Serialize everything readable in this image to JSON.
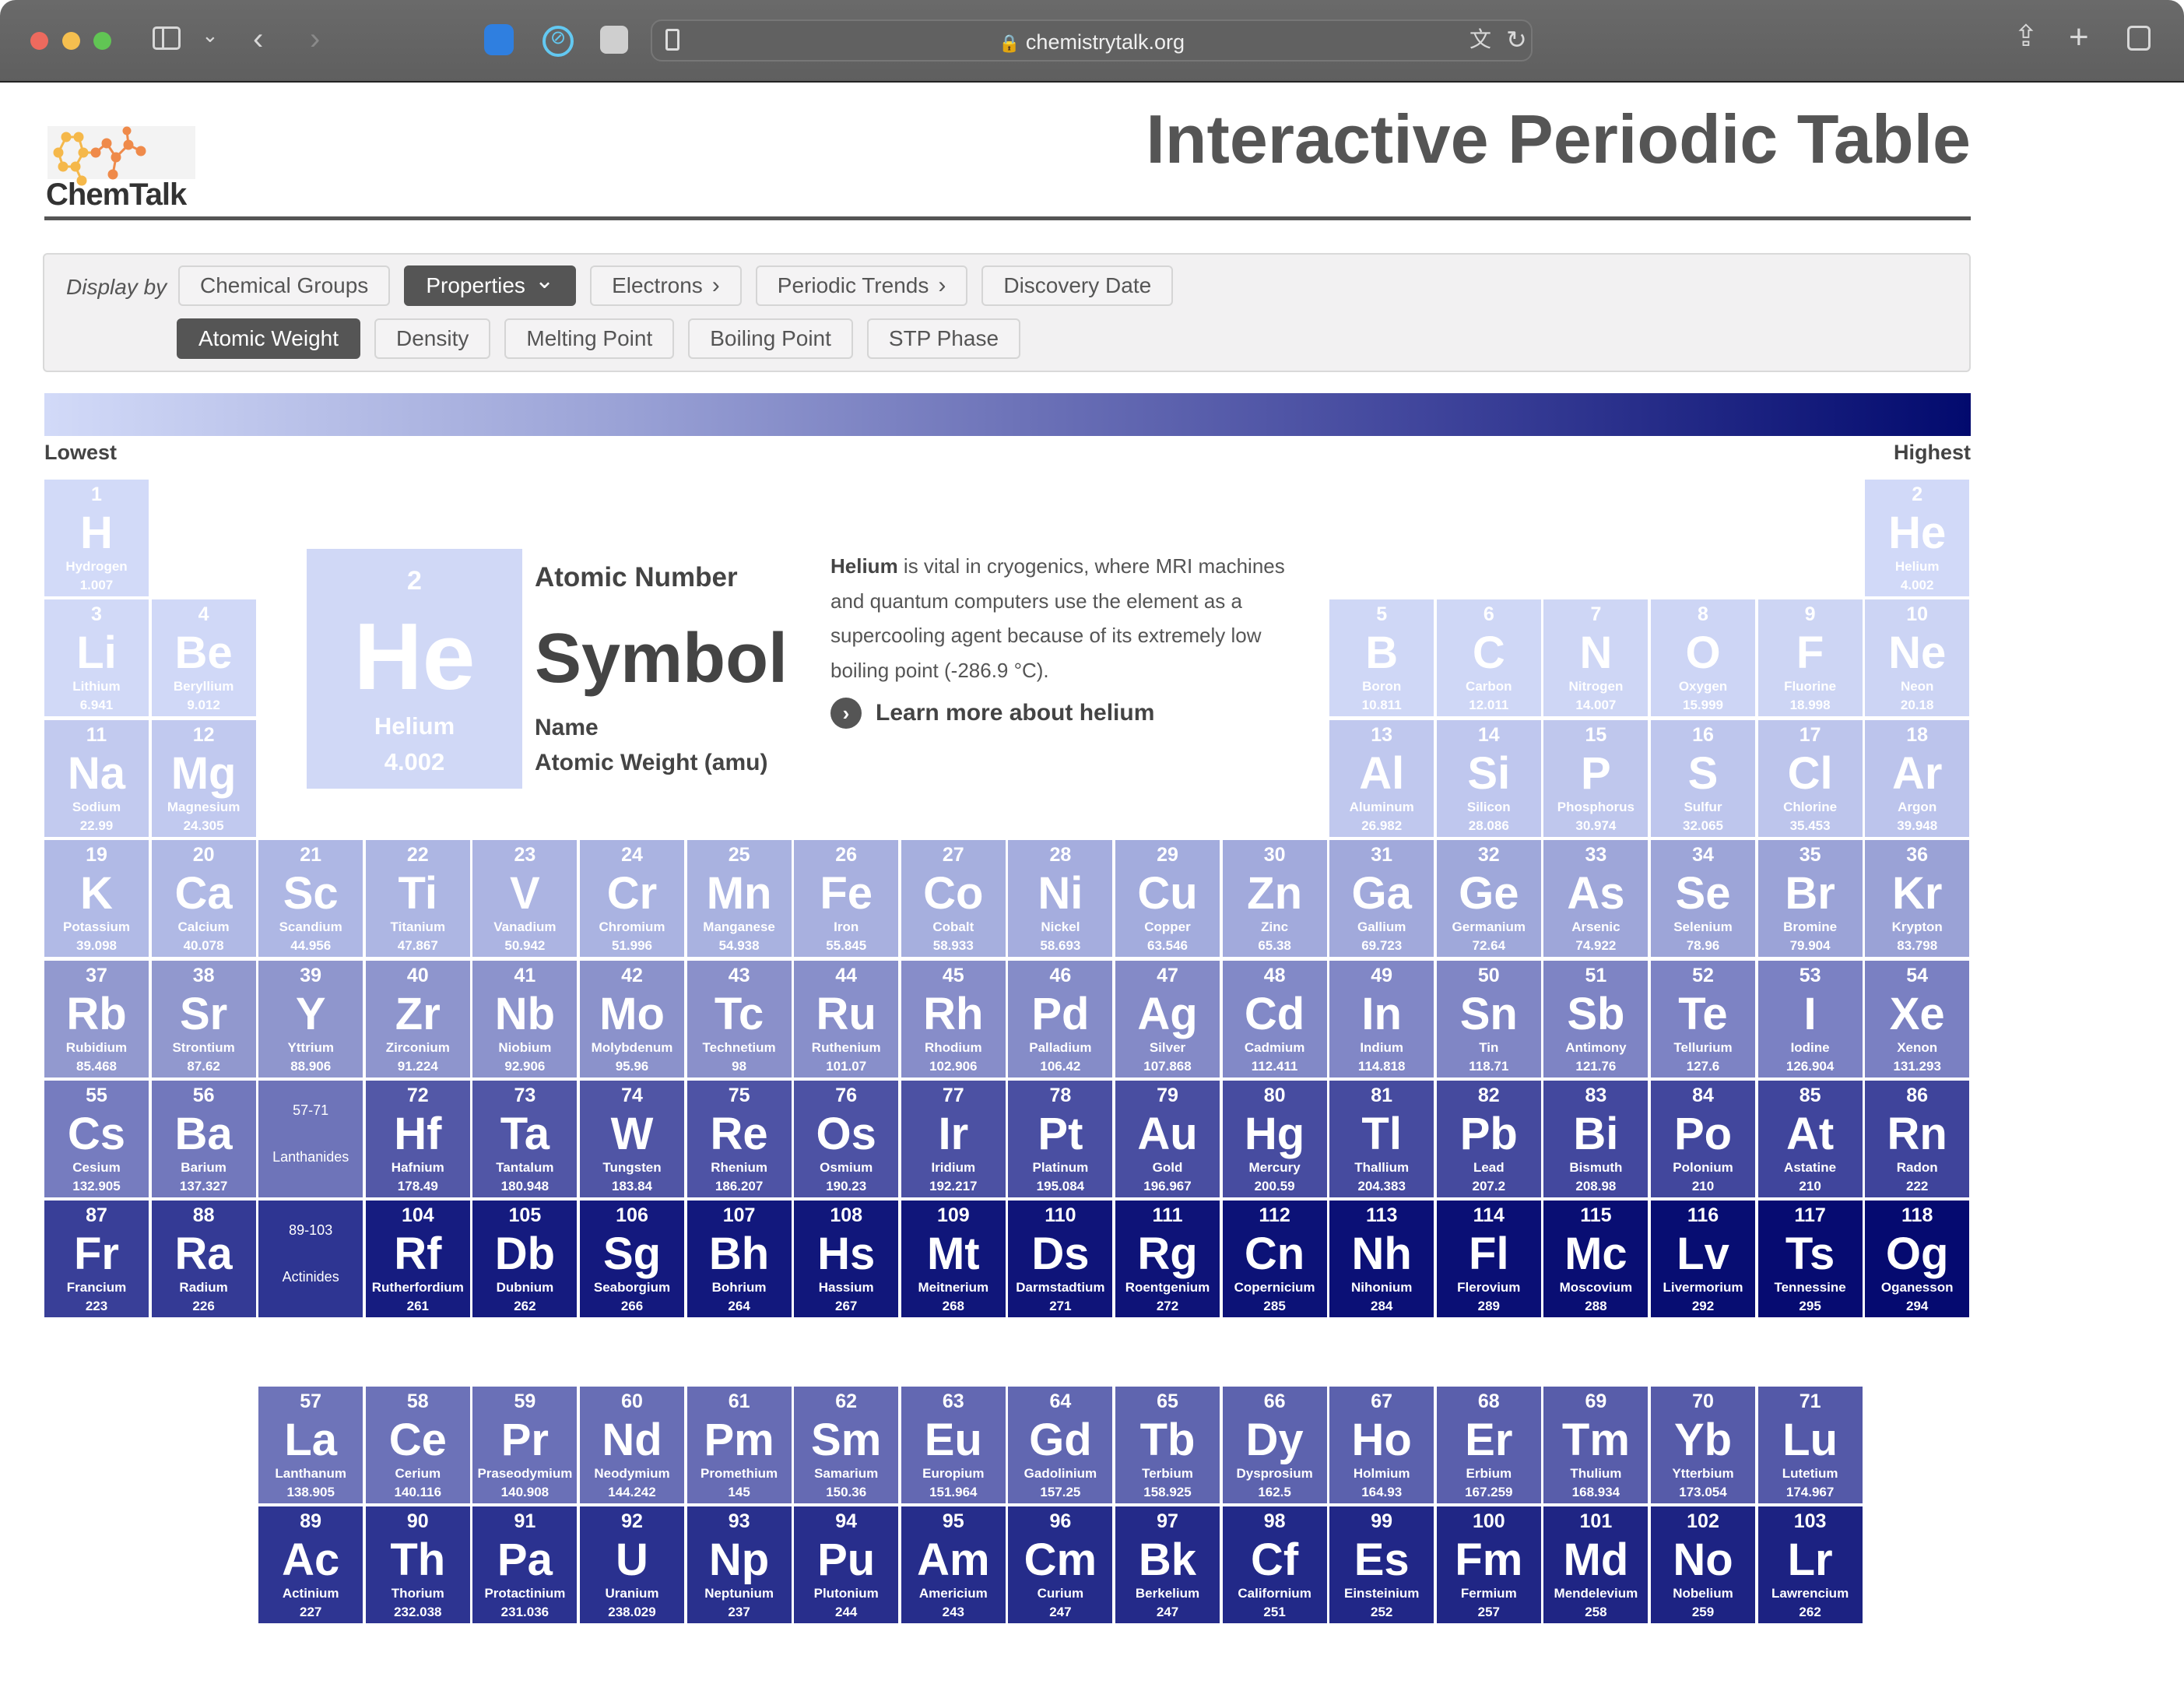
{
  "browser": {
    "url": "chemistrytalk.org",
    "icons": [
      "sidebar-icon",
      "chevron-down-icon",
      "back-icon",
      "forward-icon",
      "hand-extension-icon",
      "blocker-extension-icon",
      "disabled-extension-icon",
      "reader-icon",
      "lock-icon",
      "translate-icon",
      "reload-icon",
      "share-icon",
      "new-tab-icon",
      "tabs-overview-icon"
    ]
  },
  "header": {
    "logo_text": "ChemTalk",
    "title": "Interactive Periodic Table"
  },
  "controls": {
    "display_by": "Display by",
    "row1": [
      {
        "label": "Chemical Groups",
        "active": false,
        "chevron": ""
      },
      {
        "label": "Properties",
        "active": true,
        "chevron": "⌄"
      },
      {
        "label": "Electrons",
        "active": false,
        "chevron": "›"
      },
      {
        "label": "Periodic Trends",
        "active": false,
        "chevron": "›"
      },
      {
        "label": "Discovery Date",
        "active": false,
        "chevron": ""
      }
    ],
    "row2": [
      {
        "label": "Atomic Weight",
        "active": true
      },
      {
        "label": "Density",
        "active": false
      },
      {
        "label": "Melting Point",
        "active": false
      },
      {
        "label": "Boiling Point",
        "active": false
      },
      {
        "label": "STP Phase",
        "active": false
      }
    ]
  },
  "scale": {
    "low_label": "Lowest",
    "high_label": "Highest",
    "low_color": "#d2daf8",
    "high_color": "#020a6e",
    "color_stops_by_atomic_number": [
      [
        1,
        "#d2daf8"
      ],
      [
        10,
        "#ccd4f4"
      ],
      [
        11,
        "#c2caef"
      ],
      [
        18,
        "#bcc4ec"
      ],
      [
        19,
        "#b1bae6"
      ],
      [
        36,
        "#9aa2d6"
      ],
      [
        37,
        "#9299cf"
      ],
      [
        54,
        "#7a80c2"
      ],
      [
        57,
        "#6e74b9"
      ],
      [
        71,
        "#5459a8"
      ],
      [
        86,
        "#3f449b"
      ],
      [
        89,
        "#2e3592"
      ],
      [
        103,
        "#1c2282"
      ],
      [
        104,
        "#161c80"
      ],
      [
        118,
        "#050a70"
      ]
    ]
  },
  "featured": {
    "number": "2",
    "symbol": "He",
    "name": "Helium",
    "weight": "4.002",
    "key_number": "Atomic Number",
    "key_symbol": "Symbol",
    "key_name": "Name",
    "key_weight": "Atomic Weight (amu)",
    "desc_bold": "Helium",
    "desc_rest": " is vital in cryogenics, where MRI machines and quantum computers use the element as a supercooling agent because of its extremely low boiling point (-286.9 °C).",
    "learn_more": "Learn more about helium"
  },
  "placeholders": [
    {
      "range": "57-71",
      "label": "Lanthanides"
    },
    {
      "range": "89-103",
      "label": "Actinides"
    }
  ],
  "elements": [
    {
      "z": "1",
      "symbol": "H",
      "name": "Hydrogen",
      "weight": "1.007"
    },
    {
      "z": "2",
      "symbol": "He",
      "name": "Helium",
      "weight": "4.002"
    },
    {
      "z": "3",
      "symbol": "Li",
      "name": "Lithium",
      "weight": "6.941"
    },
    {
      "z": "4",
      "symbol": "Be",
      "name": "Beryllium",
      "weight": "9.012"
    },
    {
      "z": "5",
      "symbol": "B",
      "name": "Boron",
      "weight": "10.811"
    },
    {
      "z": "6",
      "symbol": "C",
      "name": "Carbon",
      "weight": "12.011"
    },
    {
      "z": "7",
      "symbol": "N",
      "name": "Nitrogen",
      "weight": "14.007"
    },
    {
      "z": "8",
      "symbol": "O",
      "name": "Oxygen",
      "weight": "15.999"
    },
    {
      "z": "9",
      "symbol": "F",
      "name": "Fluorine",
      "weight": "18.998"
    },
    {
      "z": "10",
      "symbol": "Ne",
      "name": "Neon",
      "weight": "20.18"
    },
    {
      "z": "11",
      "symbol": "Na",
      "name": "Sodium",
      "weight": "22.99"
    },
    {
      "z": "12",
      "symbol": "Mg",
      "name": "Magnesium",
      "weight": "24.305"
    },
    {
      "z": "13",
      "symbol": "Al",
      "name": "Aluminum",
      "weight": "26.982"
    },
    {
      "z": "14",
      "symbol": "Si",
      "name": "Silicon",
      "weight": "28.086"
    },
    {
      "z": "15",
      "symbol": "P",
      "name": "Phosphorus",
      "weight": "30.974"
    },
    {
      "z": "16",
      "symbol": "S",
      "name": "Sulfur",
      "weight": "32.065"
    },
    {
      "z": "17",
      "symbol": "Cl",
      "name": "Chlorine",
      "weight": "35.453"
    },
    {
      "z": "18",
      "symbol": "Ar",
      "name": "Argon",
      "weight": "39.948"
    },
    {
      "z": "19",
      "symbol": "K",
      "name": "Potassium",
      "weight": "39.098"
    },
    {
      "z": "20",
      "symbol": "Ca",
      "name": "Calcium",
      "weight": "40.078"
    },
    {
      "z": "21",
      "symbol": "Sc",
      "name": "Scandium",
      "weight": "44.956"
    },
    {
      "z": "22",
      "symbol": "Ti",
      "name": "Titanium",
      "weight": "47.867"
    },
    {
      "z": "23",
      "symbol": "V",
      "name": "Vanadium",
      "weight": "50.942"
    },
    {
      "z": "24",
      "symbol": "Cr",
      "name": "Chromium",
      "weight": "51.996"
    },
    {
      "z": "25",
      "symbol": "Mn",
      "name": "Manganese",
      "weight": "54.938"
    },
    {
      "z": "26",
      "symbol": "Fe",
      "name": "Iron",
      "weight": "55.845"
    },
    {
      "z": "27",
      "symbol": "Co",
      "name": "Cobalt",
      "weight": "58.933"
    },
    {
      "z": "28",
      "symbol": "Ni",
      "name": "Nickel",
      "weight": "58.693"
    },
    {
      "z": "29",
      "symbol": "Cu",
      "name": "Copper",
      "weight": "63.546"
    },
    {
      "z": "30",
      "symbol": "Zn",
      "name": "Zinc",
      "weight": "65.38"
    },
    {
      "z": "31",
      "symbol": "Ga",
      "name": "Gallium",
      "weight": "69.723"
    },
    {
      "z": "32",
      "symbol": "Ge",
      "name": "Germanium",
      "weight": "72.64"
    },
    {
      "z": "33",
      "symbol": "As",
      "name": "Arsenic",
      "weight": "74.922"
    },
    {
      "z": "34",
      "symbol": "Se",
      "name": "Selenium",
      "weight": "78.96"
    },
    {
      "z": "35",
      "symbol": "Br",
      "name": "Bromine",
      "weight": "79.904"
    },
    {
      "z": "36",
      "symbol": "Kr",
      "name": "Krypton",
      "weight": "83.798"
    },
    {
      "z": "37",
      "symbol": "Rb",
      "name": "Rubidium",
      "weight": "85.468"
    },
    {
      "z": "38",
      "symbol": "Sr",
      "name": "Strontium",
      "weight": "87.62"
    },
    {
      "z": "39",
      "symbol": "Y",
      "name": "Yttrium",
      "weight": "88.906"
    },
    {
      "z": "40",
      "symbol": "Zr",
      "name": "Zirconium",
      "weight": "91.224"
    },
    {
      "z": "41",
      "symbol": "Nb",
      "name": "Niobium",
      "weight": "92.906"
    },
    {
      "z": "42",
      "symbol": "Mo",
      "name": "Molybdenum",
      "weight": "95.96"
    },
    {
      "z": "43",
      "symbol": "Tc",
      "name": "Technetium",
      "weight": "98"
    },
    {
      "z": "44",
      "symbol": "Ru",
      "name": "Ruthenium",
      "weight": "101.07"
    },
    {
      "z": "45",
      "symbol": "Rh",
      "name": "Rhodium",
      "weight": "102.906"
    },
    {
      "z": "46",
      "symbol": "Pd",
      "name": "Palladium",
      "weight": "106.42"
    },
    {
      "z": "47",
      "symbol": "Ag",
      "name": "Silver",
      "weight": "107.868"
    },
    {
      "z": "48",
      "symbol": "Cd",
      "name": "Cadmium",
      "weight": "112.411"
    },
    {
      "z": "49",
      "symbol": "In",
      "name": "Indium",
      "weight": "114.818"
    },
    {
      "z": "50",
      "symbol": "Sn",
      "name": "Tin",
      "weight": "118.71"
    },
    {
      "z": "51",
      "symbol": "Sb",
      "name": "Antimony",
      "weight": "121.76"
    },
    {
      "z": "52",
      "symbol": "Te",
      "name": "Tellurium",
      "weight": "127.6"
    },
    {
      "z": "53",
      "symbol": "I",
      "name": "Iodine",
      "weight": "126.904"
    },
    {
      "z": "54",
      "symbol": "Xe",
      "name": "Xenon",
      "weight": "131.293"
    },
    {
      "z": "55",
      "symbol": "Cs",
      "name": "Cesium",
      "weight": "132.905"
    },
    {
      "z": "56",
      "symbol": "Ba",
      "name": "Barium",
      "weight": "137.327"
    },
    {
      "z": "57",
      "symbol": "La",
      "name": "Lanthanum",
      "weight": "138.905"
    },
    {
      "z": "58",
      "symbol": "Ce",
      "name": "Cerium",
      "weight": "140.116"
    },
    {
      "z": "59",
      "symbol": "Pr",
      "name": "Praseodymium",
      "weight": "140.908"
    },
    {
      "z": "60",
      "symbol": "Nd",
      "name": "Neodymium",
      "weight": "144.242"
    },
    {
      "z": "61",
      "symbol": "Pm",
      "name": "Promethium",
      "weight": "145"
    },
    {
      "z": "62",
      "symbol": "Sm",
      "name": "Samarium",
      "weight": "150.36"
    },
    {
      "z": "63",
      "symbol": "Eu",
      "name": "Europium",
      "weight": "151.964"
    },
    {
      "z": "64",
      "symbol": "Gd",
      "name": "Gadolinium",
      "weight": "157.25"
    },
    {
      "z": "65",
      "symbol": "Tb",
      "name": "Terbium",
      "weight": "158.925"
    },
    {
      "z": "66",
      "symbol": "Dy",
      "name": "Dysprosium",
      "weight": "162.5"
    },
    {
      "z": "67",
      "symbol": "Ho",
      "name": "Holmium",
      "weight": "164.93"
    },
    {
      "z": "68",
      "symbol": "Er",
      "name": "Erbium",
      "weight": "167.259"
    },
    {
      "z": "69",
      "symbol": "Tm",
      "name": "Thulium",
      "weight": "168.934"
    },
    {
      "z": "70",
      "symbol": "Yb",
      "name": "Ytterbium",
      "weight": "173.054"
    },
    {
      "z": "71",
      "symbol": "Lu",
      "name": "Lutetium",
      "weight": "174.967"
    },
    {
      "z": "72",
      "symbol": "Hf",
      "name": "Hafnium",
      "weight": "178.49"
    },
    {
      "z": "73",
      "symbol": "Ta",
      "name": "Tantalum",
      "weight": "180.948"
    },
    {
      "z": "74",
      "symbol": "W",
      "name": "Tungsten",
      "weight": "183.84"
    },
    {
      "z": "75",
      "symbol": "Re",
      "name": "Rhenium",
      "weight": "186.207"
    },
    {
      "z": "76",
      "symbol": "Os",
      "name": "Osmium",
      "weight": "190.23"
    },
    {
      "z": "77",
      "symbol": "Ir",
      "name": "Iridium",
      "weight": "192.217"
    },
    {
      "z": "78",
      "symbol": "Pt",
      "name": "Platinum",
      "weight": "195.084"
    },
    {
      "z": "79",
      "symbol": "Au",
      "name": "Gold",
      "weight": "196.967"
    },
    {
      "z": "80",
      "symbol": "Hg",
      "name": "Mercury",
      "weight": "200.59"
    },
    {
      "z": "81",
      "symbol": "Tl",
      "name": "Thallium",
      "weight": "204.383"
    },
    {
      "z": "82",
      "symbol": "Pb",
      "name": "Lead",
      "weight": "207.2"
    },
    {
      "z": "83",
      "symbol": "Bi",
      "name": "Bismuth",
      "weight": "208.98"
    },
    {
      "z": "84",
      "symbol": "Po",
      "name": "Polonium",
      "weight": "210"
    },
    {
      "z": "85",
      "symbol": "At",
      "name": "Astatine",
      "weight": "210"
    },
    {
      "z": "86",
      "symbol": "Rn",
      "name": "Radon",
      "weight": "222"
    },
    {
      "z": "87",
      "symbol": "Fr",
      "name": "Francium",
      "weight": "223"
    },
    {
      "z": "88",
      "symbol": "Ra",
      "name": "Radium",
      "weight": "226"
    },
    {
      "z": "89",
      "symbol": "Ac",
      "name": "Actinium",
      "weight": "227"
    },
    {
      "z": "90",
      "symbol": "Th",
      "name": "Thorium",
      "weight": "232.038"
    },
    {
      "z": "91",
      "symbol": "Pa",
      "name": "Protactinium",
      "weight": "231.036"
    },
    {
      "z": "92",
      "symbol": "U",
      "name": "Uranium",
      "weight": "238.029"
    },
    {
      "z": "93",
      "symbol": "Np",
      "name": "Neptunium",
      "weight": "237"
    },
    {
      "z": "94",
      "symbol": "Pu",
      "name": "Plutonium",
      "weight": "244"
    },
    {
      "z": "95",
      "symbol": "Am",
      "name": "Americium",
      "weight": "243"
    },
    {
      "z": "96",
      "symbol": "Cm",
      "name": "Curium",
      "weight": "247"
    },
    {
      "z": "97",
      "symbol": "Bk",
      "name": "Berkelium",
      "weight": "247"
    },
    {
      "z": "98",
      "symbol": "Cf",
      "name": "Californium",
      "weight": "251"
    },
    {
      "z": "99",
      "symbol": "Es",
      "name": "Einsteinium",
      "weight": "252"
    },
    {
      "z": "100",
      "symbol": "Fm",
      "name": "Fermium",
      "weight": "257"
    },
    {
      "z": "101",
      "symbol": "Md",
      "name": "Mendelevium",
      "weight": "258"
    },
    {
      "z": "102",
      "symbol": "No",
      "name": "Nobelium",
      "weight": "259"
    },
    {
      "z": "103",
      "symbol": "Lr",
      "name": "Lawrencium",
      "weight": "262"
    },
    {
      "z": "104",
      "symbol": "Rf",
      "name": "Rutherfordium",
      "weight": "261"
    },
    {
      "z": "105",
      "symbol": "Db",
      "name": "Dubnium",
      "weight": "262"
    },
    {
      "z": "106",
      "symbol": "Sg",
      "name": "Seaborgium",
      "weight": "266"
    },
    {
      "z": "107",
      "symbol": "Bh",
      "name": "Bohrium",
      "weight": "264"
    },
    {
      "z": "108",
      "symbol": "Hs",
      "name": "Hassium",
      "weight": "267"
    },
    {
      "z": "109",
      "symbol": "Mt",
      "name": "Meitnerium",
      "weight": "268"
    },
    {
      "z": "110",
      "symbol": "Ds",
      "name": "Darmstadtium",
      "weight": "271"
    },
    {
      "z": "111",
      "symbol": "Rg",
      "name": "Roentgenium",
      "weight": "272"
    },
    {
      "z": "112",
      "symbol": "Cn",
      "name": "Copernicium",
      "weight": "285"
    },
    {
      "z": "113",
      "symbol": "Nh",
      "name": "Nihonium",
      "weight": "284"
    },
    {
      "z": "114",
      "symbol": "Fl",
      "name": "Flerovium",
      "weight": "289"
    },
    {
      "z": "115",
      "symbol": "Mc",
      "name": "Moscovium",
      "weight": "288"
    },
    {
      "z": "116",
      "symbol": "Lv",
      "name": "Livermorium",
      "weight": "292"
    },
    {
      "z": "117",
      "symbol": "Ts",
      "name": "Tennessine",
      "weight": "295"
    },
    {
      "z": "118",
      "symbol": "Og",
      "name": "Oganesson",
      "weight": "294"
    }
  ]
}
